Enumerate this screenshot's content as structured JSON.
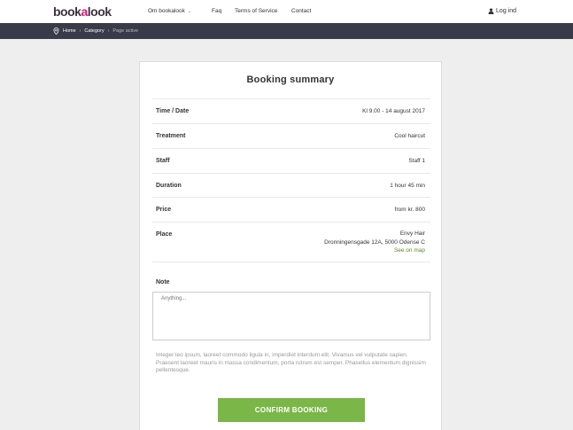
{
  "header": {
    "logo": {
      "part1": "book",
      "part2": "a",
      "part3": "look"
    },
    "nav": [
      {
        "label": "Om bookalook",
        "has_dropdown": true
      },
      {
        "label": "Faq"
      },
      {
        "label": "Terms of Service"
      },
      {
        "label": "Contact"
      }
    ],
    "login_label": "Log ind",
    "login_icon": "user-icon"
  },
  "breadcrumb": {
    "icon": "location-pin-icon",
    "items": [
      "Home",
      "Category"
    ],
    "active": "Page active"
  },
  "summary": {
    "title": "Booking summary",
    "rows": [
      {
        "label": "Time / Date",
        "value": "Kl 9.00 - 14 august 2017"
      },
      {
        "label": "Treatment",
        "value": "Cool haircut"
      },
      {
        "label": "Staff",
        "value": "Staff 1"
      },
      {
        "label": "Duration",
        "value": "1 hour 45 min"
      },
      {
        "label": "Price",
        "value": "from kr. 800"
      },
      {
        "label": "Place",
        "value_lines": [
          "Envy Hair",
          "Dronningensgade 12A, 5000 Odense C"
        ],
        "link": "See on map"
      }
    ],
    "note_label": "Note",
    "note_placeholder": "Anything...",
    "lorem": "Integer leo ipsum, laoreet commodo ligula in, imperdiet interdum elit. Vivamus vel vulputate sapien. Praesent laoreet mauris in massa condimentum, porta rutrum est semper. Phasellus elementum dignissim pellentesque.",
    "confirm_label": "CONFIRM BOOKING"
  },
  "colors": {
    "brand_green": "#7ab648",
    "brand_pink": "#e2127a",
    "header_dark": "#3b3a48",
    "page_bg": "#eeeeee"
  }
}
